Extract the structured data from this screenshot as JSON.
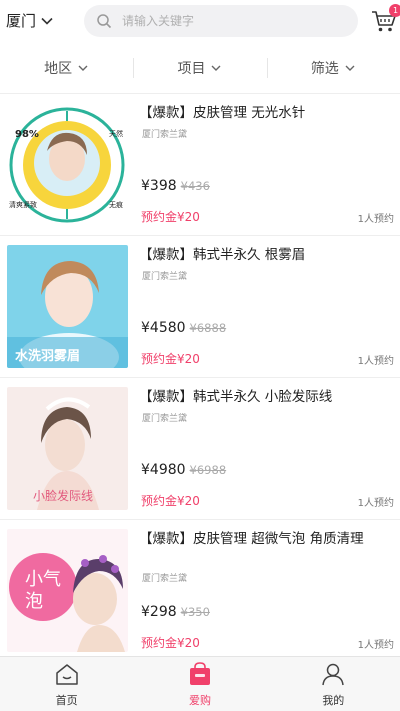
{
  "header": {
    "city": "厦门",
    "search_placeholder": "请输入关键字",
    "cart_badge": "1"
  },
  "filters": [
    {
      "label": "地区"
    },
    {
      "label": "项目"
    },
    {
      "label": "筛选"
    }
  ],
  "products": [
    {
      "title": "【爆款】皮肤管理 无光水针",
      "store": "厦门索兰黛",
      "price": "¥398",
      "old_price": "¥436",
      "deposit": "预约金¥20",
      "booked": "1人预约",
      "image_texts": [
        "98%",
        "天然",
        "清爽紧致",
        "无痕"
      ]
    },
    {
      "title": "【爆款】韩式半永久 根雾眉",
      "store": "厦门索兰黛",
      "price": "¥4580",
      "old_price": "¥6888",
      "deposit": "预约金¥20",
      "booked": "1人预约",
      "image_texts": [
        "水洗羽雾眉"
      ]
    },
    {
      "title": "【爆款】韩式半永久 小脸发际线",
      "store": "厦门索兰黛",
      "price": "¥4980",
      "old_price": "¥6988",
      "deposit": "预约金¥20",
      "booked": "1人预约",
      "image_texts": [
        "小脸发际线"
      ]
    },
    {
      "title": "【爆款】皮肤管理 超微气泡 角质清理",
      "store": "厦门索兰黛",
      "price": "¥298",
      "old_price": "¥350",
      "deposit": "预约金¥20",
      "booked": "1人预约",
      "image_texts": [
        "小气泡"
      ]
    }
  ],
  "tabbar": {
    "items": [
      {
        "label": "首页"
      },
      {
        "label": "爱购"
      },
      {
        "label": "我的"
      }
    ],
    "active_index": 1
  },
  "colors": {
    "accent": "#f0406a",
    "search_bg": "#f1f1f3",
    "tabbar_bg": "#f7f7f7"
  }
}
